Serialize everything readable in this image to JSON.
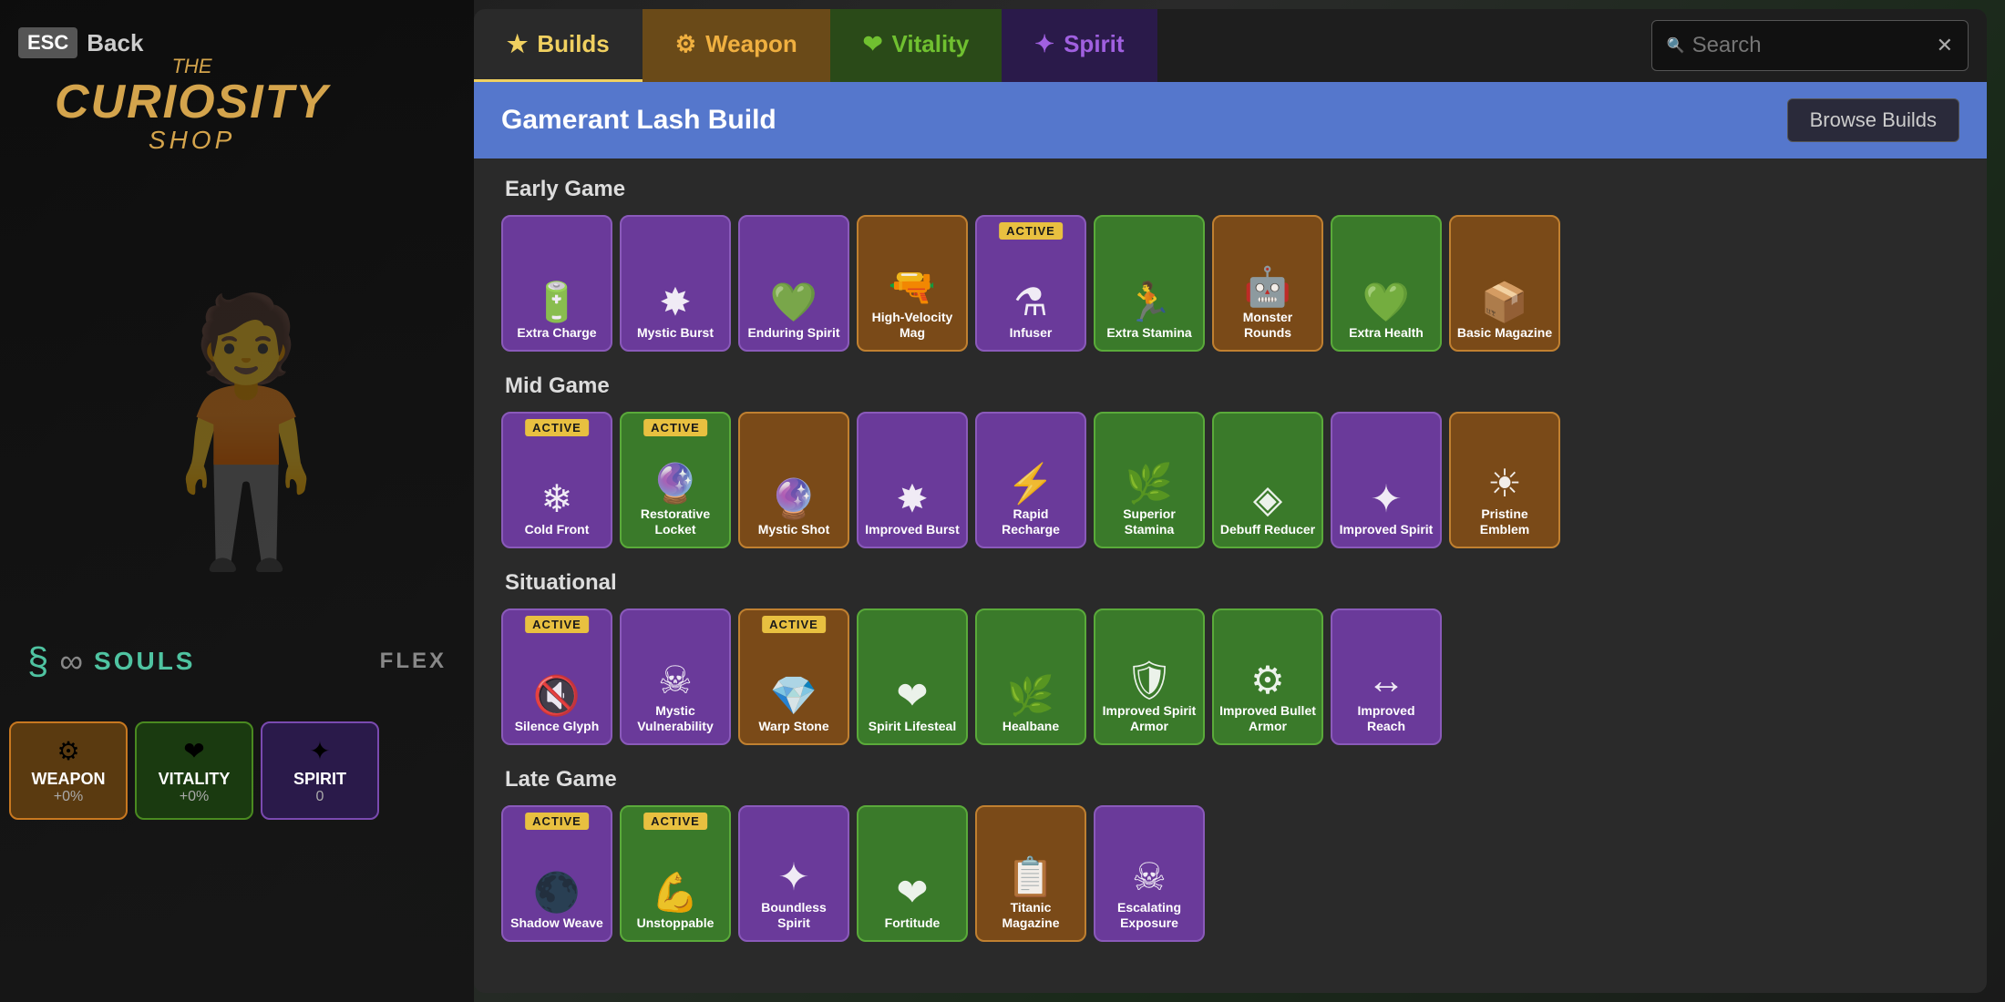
{
  "app": {
    "title": "The Curiosity Shop",
    "esc_label": "ESC",
    "back_label": "Back",
    "logo_the": "THE",
    "logo_curiosity": "CURIOSITY",
    "logo_shop": "SHOP"
  },
  "tabs": [
    {
      "id": "builds",
      "label": "Builds",
      "icon": "★",
      "active": true,
      "style": "builds"
    },
    {
      "id": "weapon",
      "label": "Weapon",
      "icon": "⚙",
      "style": "weapon"
    },
    {
      "id": "vitality",
      "label": "Vitality",
      "icon": "❤",
      "style": "vitality"
    },
    {
      "id": "spirit",
      "label": "Spirit",
      "icon": "✦",
      "style": "spirit"
    }
  ],
  "search": {
    "placeholder": "Search",
    "value": ""
  },
  "build": {
    "title": "Gamerant Lash Build",
    "browse_label": "Browse Builds"
  },
  "sections": [
    {
      "id": "early-game",
      "title": "Early Game",
      "items": [
        {
          "name": "Extra Charge",
          "color": "purple",
          "active": false,
          "icon": "🔋"
        },
        {
          "name": "Mystic Burst",
          "color": "purple",
          "active": false,
          "icon": "✸"
        },
        {
          "name": "Enduring Spirit",
          "color": "purple",
          "active": false,
          "icon": "💚"
        },
        {
          "name": "High-Velocity Mag",
          "color": "orange",
          "active": false,
          "icon": "🔫"
        },
        {
          "name": "Infuser",
          "color": "purple",
          "active": true,
          "icon": "⚗"
        },
        {
          "name": "Extra Stamina",
          "color": "green",
          "active": false,
          "icon": "🏃"
        },
        {
          "name": "Monster Rounds",
          "color": "orange",
          "active": false,
          "icon": "🤖"
        },
        {
          "name": "Extra Health",
          "color": "green",
          "active": false,
          "icon": "💚"
        },
        {
          "name": "Basic Magazine",
          "color": "orange",
          "active": false,
          "icon": "📦"
        }
      ]
    },
    {
      "id": "mid-game",
      "title": "Mid Game",
      "items": [
        {
          "name": "Cold Front",
          "color": "purple",
          "active": true,
          "icon": "❄"
        },
        {
          "name": "Restorative Locket",
          "color": "green",
          "active": true,
          "icon": "🔮"
        },
        {
          "name": "Mystic Shot",
          "color": "orange",
          "active": false,
          "icon": "🔮"
        },
        {
          "name": "Improved Burst",
          "color": "purple",
          "active": false,
          "icon": "✸"
        },
        {
          "name": "Rapid Recharge",
          "color": "purple",
          "active": false,
          "icon": "⚡"
        },
        {
          "name": "Superior Stamina",
          "color": "green",
          "active": false,
          "icon": "🌿"
        },
        {
          "name": "Debuff Reducer",
          "color": "green",
          "active": false,
          "icon": "◈"
        },
        {
          "name": "Improved Spirit",
          "color": "purple",
          "active": false,
          "icon": "✦"
        },
        {
          "name": "Pristine Emblem",
          "color": "orange",
          "active": false,
          "icon": "☀"
        }
      ]
    },
    {
      "id": "situational",
      "title": "Situational",
      "items": [
        {
          "name": "Silence Glyph",
          "color": "purple",
          "active": true,
          "icon": "🔇"
        },
        {
          "name": "Mystic Vulnerability",
          "color": "purple",
          "active": false,
          "icon": "☠"
        },
        {
          "name": "Warp Stone",
          "color": "orange",
          "active": true,
          "icon": "💎"
        },
        {
          "name": "Spirit Lifesteal",
          "color": "green",
          "active": false,
          "icon": "❤"
        },
        {
          "name": "Healbane",
          "color": "green",
          "active": false,
          "icon": "🌿"
        },
        {
          "name": "Improved Spirit Armor",
          "color": "green",
          "active": false,
          "icon": "🛡"
        },
        {
          "name": "Improved Bullet Armor",
          "color": "green",
          "active": false,
          "icon": "⚙"
        },
        {
          "name": "Improved Reach",
          "color": "purple",
          "active": false,
          "icon": "↔"
        }
      ]
    },
    {
      "id": "late-game",
      "title": "Late Game",
      "items": [
        {
          "name": "Shadow Weave",
          "color": "purple",
          "active": true,
          "icon": "🌑"
        },
        {
          "name": "Unstoppable",
          "color": "green",
          "active": true,
          "icon": "💪"
        },
        {
          "name": "Boundless Spirit",
          "color": "purple",
          "active": false,
          "icon": "✦"
        },
        {
          "name": "Fortitude",
          "color": "green",
          "active": false,
          "icon": "❤"
        },
        {
          "name": "Titanic Magazine",
          "color": "orange",
          "active": false,
          "icon": "📋"
        },
        {
          "name": "Escalating Exposure",
          "color": "purple",
          "active": false,
          "icon": "☠"
        }
      ]
    }
  ],
  "stats": {
    "souls_icon": "§",
    "souls_label": "SOULS",
    "weapon": {
      "name": "WEAPON",
      "value": "+0%",
      "icon": "⚙"
    },
    "vitality": {
      "name": "VITALITY",
      "value": "+0%",
      "icon": "❤"
    },
    "spirit": {
      "name": "SPIRIT",
      "value": "0",
      "icon": "✦"
    },
    "flex_label": "FLEX"
  },
  "colors": {
    "purple_card": "#6a3a9a",
    "green_card": "#3a7a2a",
    "orange_card": "#7a4a18",
    "active_badge": "#e8c040",
    "tab_builds": "#f0d060",
    "tab_weapon_bg": "#6a4a18",
    "tab_vitality_bg": "#2a4a18",
    "tab_spirit_bg": "#2a1a4a"
  }
}
